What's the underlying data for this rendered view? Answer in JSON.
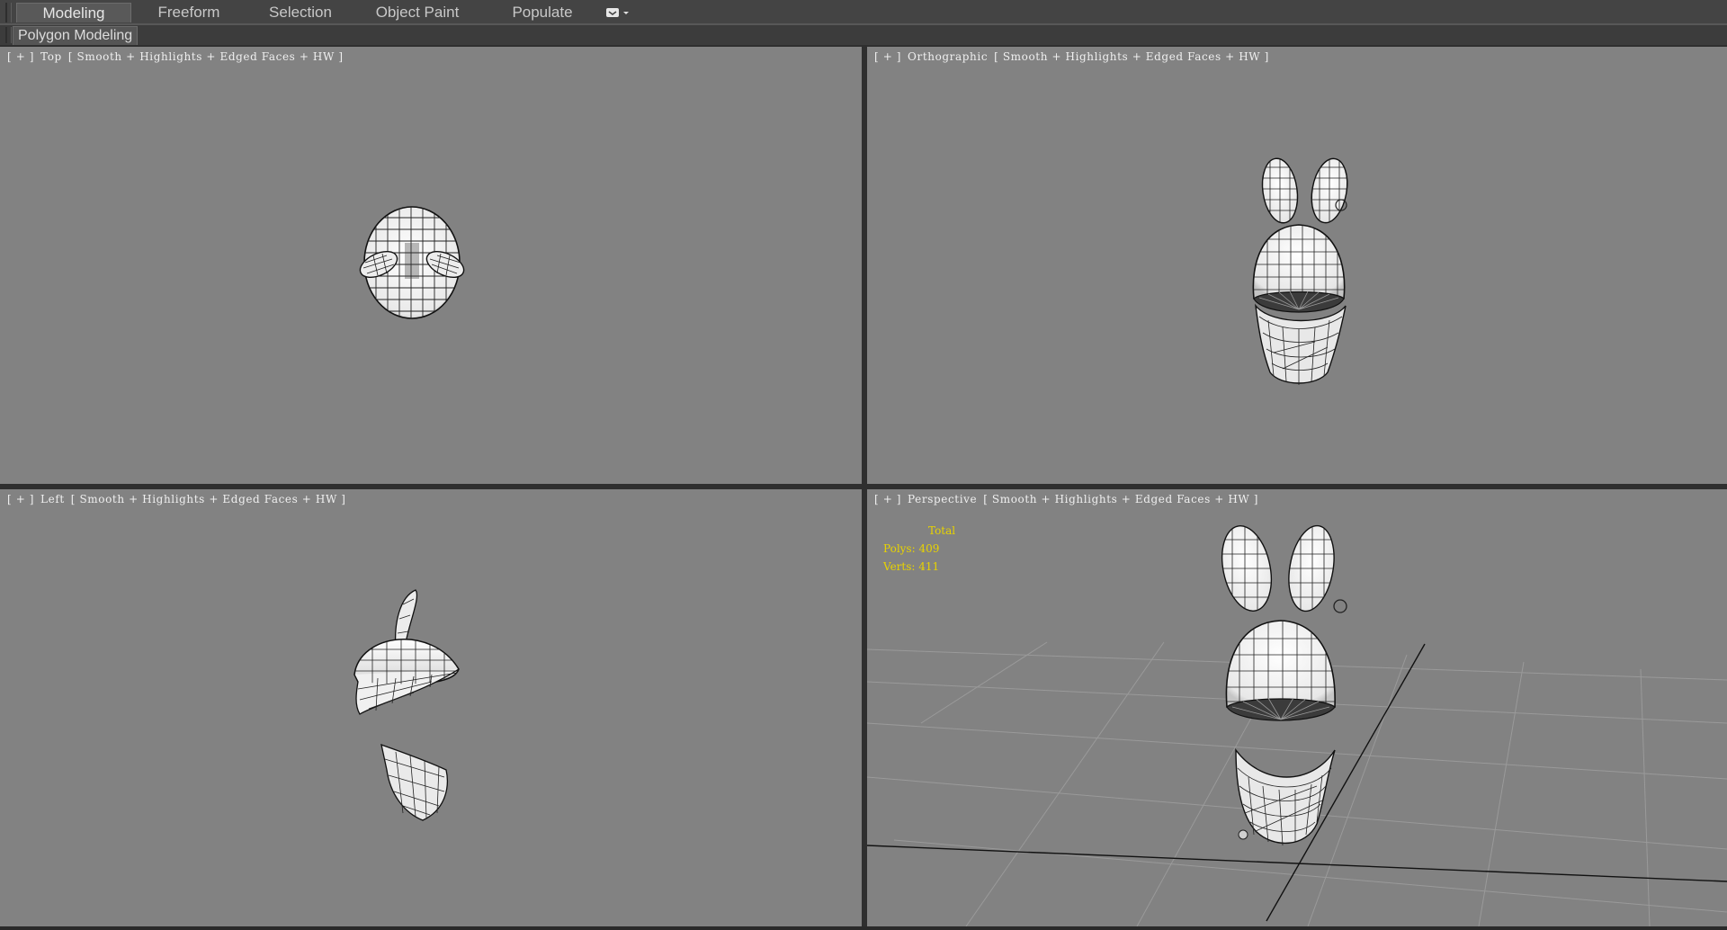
{
  "ribbon": {
    "tabs": [
      {
        "label": "Modeling",
        "active": true
      },
      {
        "label": "Freeform",
        "active": false
      },
      {
        "label": "Selection",
        "active": false
      },
      {
        "label": "Object Paint",
        "active": false
      },
      {
        "label": "Populate",
        "active": false
      }
    ],
    "options_icon": "ribbon-options-icon"
  },
  "panel": {
    "label": "Polygon Modeling"
  },
  "viewports": {
    "top": {
      "plus": "[ + ]",
      "view": "Top",
      "shading": "[ Smooth + Highlights + Edged Faces + HW ]"
    },
    "ortho": {
      "plus": "[ + ]",
      "view": "Orthographic",
      "shading": "[ Smooth + Highlights + Edged Faces + HW ]"
    },
    "left": {
      "plus": "[ + ]",
      "view": "Left",
      "shading": "[ Smooth + Highlights + Edged Faces + HW ]"
    },
    "persp": {
      "plus": "[ + ]",
      "view": "Perspective",
      "shading": "[ Smooth + Highlights + Edged Faces + HW ]"
    }
  },
  "stats": {
    "total_label": "Total",
    "polys": "Polys: 409",
    "verts": "Verts: 411"
  },
  "colors": {
    "viewport_bg": "#828282",
    "stats_text": "#e8d300",
    "active_tab": "#595959"
  }
}
